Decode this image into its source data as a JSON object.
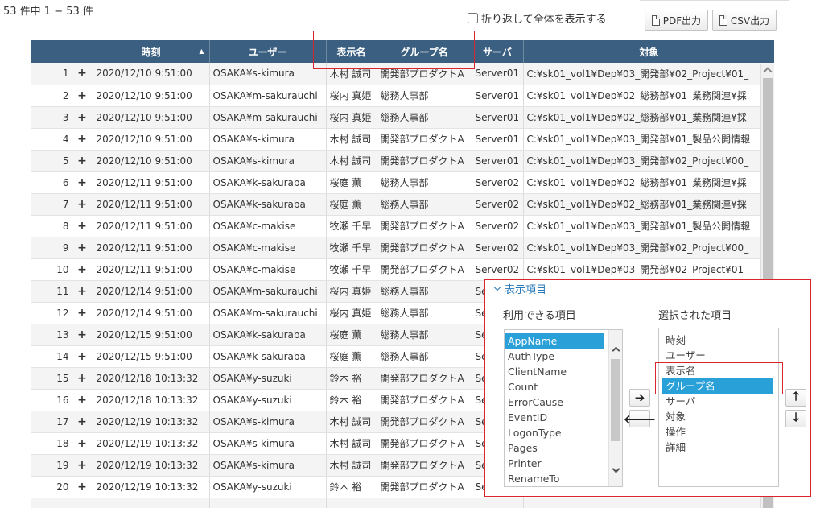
{
  "summary": "53 件中 1 − 53 件",
  "wrap_option": {
    "label": "折り返して全体を表示する",
    "checked": false
  },
  "buttons": {
    "pdf": "PDF出力",
    "csv": "CSV出力"
  },
  "columns": [
    "",
    "",
    "時刻",
    "ユーザー",
    "表示名",
    "グループ名",
    "サーバ",
    "対象"
  ],
  "rows": [
    [
      "1",
      "+",
      "2020/12/10 9:51:00",
      "OSAKA¥s-kimura",
      "木村 誠司",
      "開発部プロダクトA",
      "Server01",
      "C:¥sk01_vol1¥Dep¥03_開発部¥02_Project¥01_"
    ],
    [
      "2",
      "+",
      "2020/12/10 9:51:00",
      "OSAKA¥m-sakurauchi",
      "桜内 真姫",
      "総務人事部",
      "Server01",
      "C:¥sk01_vol1¥Dep¥02_総務部¥01_業務関連¥採"
    ],
    [
      "3",
      "+",
      "2020/12/10 9:51:00",
      "OSAKA¥m-sakurauchi",
      "桜内 真姫",
      "総務人事部",
      "Server01",
      "C:¥sk01_vol1¥Dep¥02_総務部¥01_業務関連¥採"
    ],
    [
      "4",
      "+",
      "2020/12/10 9:51:00",
      "OSAKA¥s-kimura",
      "木村 誠司",
      "開発部プロダクトA",
      "Server01",
      "C:¥sk01_vol1¥Dep¥03_開発部¥01_製品公開情報"
    ],
    [
      "5",
      "+",
      "2020/12/10 9:51:00",
      "OSAKA¥s-kimura",
      "木村 誠司",
      "開発部プロダクトA",
      "Server01",
      "C:¥sk01_vol1¥Dep¥03_開発部¥02_Project¥00_"
    ],
    [
      "6",
      "+",
      "2020/12/11 9:51:00",
      "OSAKA¥k-sakuraba",
      "桜庭 薫",
      "総務人事部",
      "Server02",
      "C:¥sk01_vol1¥Dep¥02_総務部¥01_業務関連¥採"
    ],
    [
      "7",
      "+",
      "2020/12/11 9:51:00",
      "OSAKA¥k-sakuraba",
      "桜庭 薫",
      "総務人事部",
      "Server02",
      "C:¥sk01_vol1¥Dep¥02_総務部¥01_業務関連¥採"
    ],
    [
      "8",
      "+",
      "2020/12/11 9:51:00",
      "OSAKA¥c-makise",
      "牧瀬 千早",
      "開発部プロダクトA",
      "Server02",
      "C:¥sk01_vol1¥Dep¥03_開発部¥01_製品公開情報"
    ],
    [
      "9",
      "+",
      "2020/12/11 9:51:00",
      "OSAKA¥c-makise",
      "牧瀬 千早",
      "開発部プロダクトA",
      "Server02",
      "C:¥sk01_vol1¥Dep¥03_開発部¥02_Project¥00_"
    ],
    [
      "10",
      "+",
      "2020/12/11 9:51:00",
      "OSAKA¥c-makise",
      "牧瀬 千早",
      "開発部プロダクトA",
      "Server02",
      "C:¥sk01_vol1¥Dep¥03_開発部¥02_Project¥01_"
    ],
    [
      "11",
      "+",
      "2020/12/14 9:51:00",
      "OSAKA¥m-sakurauchi",
      "桜内 真姫",
      "総務人事部",
      "Se",
      ""
    ],
    [
      "12",
      "+",
      "2020/12/14 9:51:00",
      "OSAKA¥m-sakurauchi",
      "桜内 真姫",
      "総務人事部",
      "Se",
      ""
    ],
    [
      "13",
      "+",
      "2020/12/15 9:51:00",
      "OSAKA¥k-sakuraba",
      "桜庭 薫",
      "総務人事部",
      "Se",
      ""
    ],
    [
      "14",
      "+",
      "2020/12/15 9:51:00",
      "OSAKA¥k-sakuraba",
      "桜庭 薫",
      "総務人事部",
      "Se",
      ""
    ],
    [
      "15",
      "+",
      "2020/12/18 10:13:32",
      "OSAKA¥y-suzuki",
      "鈴木 裕",
      "開発部プロダクトA",
      "Se",
      ""
    ],
    [
      "16",
      "+",
      "2020/12/18 10:13:32",
      "OSAKA¥y-suzuki",
      "鈴木 裕",
      "開発部プロダクトA",
      "Se",
      ""
    ],
    [
      "17",
      "+",
      "2020/12/19 10:13:32",
      "OSAKA¥s-kimura",
      "木村 誠司",
      "開発部プロダクトA",
      "Se",
      ""
    ],
    [
      "18",
      "+",
      "2020/12/19 10:13:32",
      "OSAKA¥s-kimura",
      "木村 誠司",
      "開発部プロダクトA",
      "Se",
      ""
    ],
    [
      "19",
      "+",
      "2020/12/19 10:13:32",
      "OSAKA¥s-kimura",
      "木村 誠司",
      "開発部プロダクトA",
      "Se",
      ""
    ],
    [
      "20",
      "+",
      "2020/12/19 10:13:32",
      "OSAKA¥y-suzuki",
      "鈴木 裕",
      "開発部プロダクトA",
      "Se",
      ""
    ],
    [
      "",
      "",
      "",
      "",
      "",
      "",
      "",
      ""
    ]
  ],
  "panel": {
    "toggle_label": "表示項目",
    "available_label": "利用できる項目",
    "selected_label": "選択された項目",
    "available_items": [
      "AppName",
      "AuthType",
      "ClientName",
      "Count",
      "ErrorCause",
      "EventID",
      "LogonType",
      "Pages",
      "Printer",
      "RenameTo"
    ],
    "available_selected_index": 0,
    "selected_items": [
      "時刻",
      "ユーザー",
      "表示名",
      "グループ名",
      "サーバ",
      "対象",
      "操作",
      "詳細"
    ],
    "selected_selected_index": 3,
    "arrows": {
      "right": "➔",
      "left": "🡐",
      "up": "🡑",
      "down": "🡓"
    }
  },
  "colors": {
    "header_bg": "#3a5f80",
    "accent": "#2aa0d8",
    "highlight": "#d9252d",
    "link": "#2a7ab8"
  }
}
